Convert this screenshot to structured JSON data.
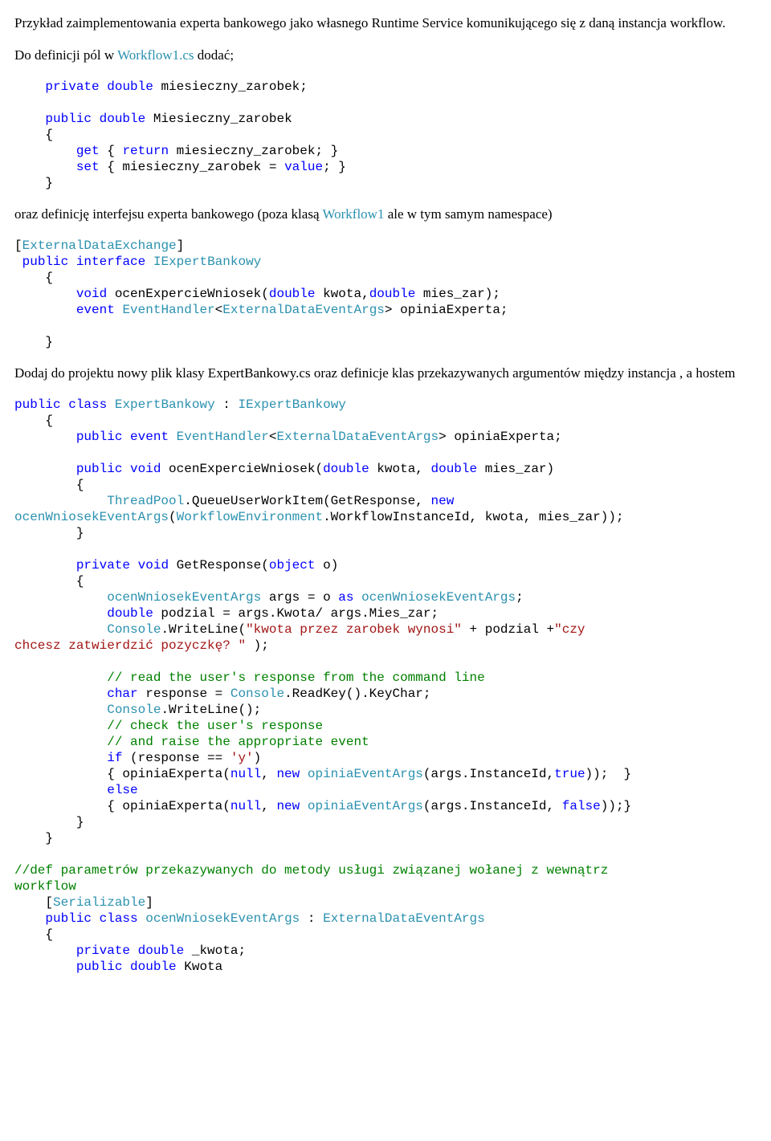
{
  "p1": "Przykład zaimplementowania experta bankowego jako własnego Runtime Service komunikującego się z daną instancja workflow.",
  "p2a": "Do definicji pól w ",
  "p2b": "Workflow1.cs",
  "p2c": " dodać;",
  "c1": {
    "l1a": "private",
    "l1b": " ",
    "l1c": "double",
    "l1d": " miesieczny_zarobek;",
    "l2a": "public",
    "l2b": " ",
    "l2c": "double",
    "l2d": " Miesieczny_zarobek",
    "l3": "{",
    "l4a": "get",
    "l4b": " { ",
    "l4c": "return",
    "l4d": " miesieczny_zarobek; }",
    "l5a": "set",
    "l5b": " { miesieczny_zarobek = ",
    "l5c": "value",
    "l5d": "; }",
    "l6": "}"
  },
  "p3a": "oraz definicję interfejsu experta bankowego (poza klasą ",
  "p3b": "Workflow1",
  "p3c": " ale w tym samym namespace)",
  "c2": {
    "l1a": "[",
    "l1b": "ExternalDataExchange",
    "l1c": "]",
    "l2a": " ",
    "l2b": "public",
    "l2c": " ",
    "l2d": "interface",
    "l2e": " ",
    "l2f": "IExpertBankowy",
    "l3": "    {",
    "l4a": "        ",
    "l4b": "void",
    "l4c": " ocenExpercieWniosek(",
    "l4d": "double",
    "l4e": " kwota,",
    "l4f": "double",
    "l4g": " mies_zar);",
    "l5a": "        ",
    "l5b": "event",
    "l5c": " ",
    "l5d": "EventHandler",
    "l5e": "<",
    "l5f": "ExternalDataEventArgs",
    "l5g": "> opiniaExperta;",
    "l6": "",
    "l7": "    }"
  },
  "p4": "Dodaj do projektu nowy plik klasy ExpertBankowy.cs oraz definicje klas przekazywanych argumentów między instancja , a hostem",
  "c3": {
    "l1a": "public",
    "l1b": " ",
    "l1c": "class",
    "l1d": " ",
    "l1e": "ExpertBankowy",
    "l1f": " : ",
    "l1g": "IExpertBankowy",
    "l2": "    {",
    "l3a": "        ",
    "l3b": "public",
    "l3c": " ",
    "l3d": "event",
    "l3e": " ",
    "l3f": "EventHandler",
    "l3g": "<",
    "l3h": "ExternalDataEventArgs",
    "l3i": "> opiniaExperta;",
    "l4": "",
    "l5a": "        ",
    "l5b": "public",
    "l5c": " ",
    "l5d": "void",
    "l5e": " ocenExpercieWniosek(",
    "l5f": "double",
    "l5g": " kwota, ",
    "l5h": "double",
    "l5i": " mies_zar)",
    "l6": "        {",
    "l7a": "            ",
    "l7b": "ThreadPool",
    "l7c": ".QueueUserWorkItem(GetResponse, ",
    "l7d": "new",
    "l8a": "ocenWniosekEventArgs",
    "l8b": "(",
    "l8c": "WorkflowEnvironment",
    "l8d": ".WorkflowInstanceId, kwota, mies_zar));",
    "l9": "        }",
    "l10": "",
    "l11a": "        ",
    "l11b": "private",
    "l11c": " ",
    "l11d": "void",
    "l11e": " GetResponse(",
    "l11f": "object",
    "l11g": " o)",
    "l12": "        {",
    "l13a": "            ",
    "l13b": "ocenWniosekEventArgs",
    "l13c": " args = o ",
    "l13d": "as",
    "l13e": " ",
    "l13f": "ocenWniosekEventArgs",
    "l13g": ";",
    "l14a": "            ",
    "l14b": "double",
    "l14c": " podzial = args.Kwota/ args.Mies_zar;",
    "l15a": "            ",
    "l15b": "Console",
    "l15c": ".WriteLine(",
    "l15d": "\"kwota przez zarobek wynosi\"",
    "l15e": " + podzial +",
    "l15f": "\"czy",
    "l16a": "chcesz zatwierdzić pozyczkę? \"",
    "l16b": " );",
    "l17": "",
    "l18a": "            ",
    "l18b": "// read the user's response from the command line",
    "l19a": "            ",
    "l19b": "char",
    "l19c": " response = ",
    "l19d": "Console",
    "l19e": ".ReadKey().KeyChar;",
    "l20a": "            ",
    "l20b": "Console",
    "l20c": ".WriteLine();",
    "l21a": "            ",
    "l21b": "// check the user's response",
    "l22a": "            ",
    "l22b": "// and raise the appropriate event",
    "l23a": "            ",
    "l23b": "if",
    "l23c": " (response == ",
    "l23d": "'y'",
    "l23e": ")",
    "l24a": "            { opiniaExperta(",
    "l24b": "null",
    "l24c": ", ",
    "l24d": "new",
    "l24e": " ",
    "l24f": "opiniaEventArgs",
    "l24g": "(args.InstanceId,",
    "l24h": "true",
    "l24i": "));  }",
    "l25a": "            ",
    "l25b": "else",
    "l26a": "            { opiniaExperta(",
    "l26b": "null",
    "l26c": ", ",
    "l26d": "new",
    "l26e": " ",
    "l26f": "opiniaEventArgs",
    "l26g": "(args.InstanceId, ",
    "l26h": "false",
    "l26i": "));}",
    "l27": "        }",
    "l28": "    }",
    "l29": "",
    "l30a": "//def parametrów przekazywanych do metody usługi związanej wołanej z wewnątrz",
    "l30b": "workflow",
    "l31a": "    [",
    "l31b": "Serializable",
    "l31c": "]",
    "l32a": "    ",
    "l32b": "public",
    "l32c": " ",
    "l32d": "class",
    "l32e": " ",
    "l32f": "ocenWniosekEventArgs",
    "l32g": " : ",
    "l32h": "ExternalDataEventArgs",
    "l33": "    {",
    "l34a": "        ",
    "l34b": "private",
    "l34c": " ",
    "l34d": "double",
    "l34e": " _kwota;",
    "l35a": "        ",
    "l35b": "public",
    "l35c": " ",
    "l35d": "double",
    "l35e": " Kwota"
  }
}
